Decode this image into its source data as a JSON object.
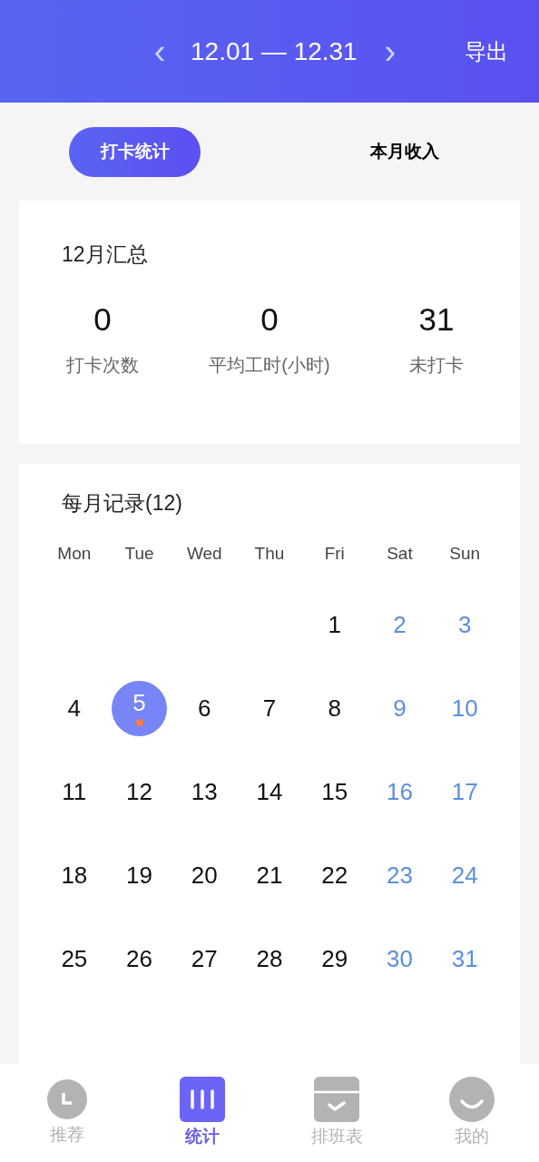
{
  "header": {
    "prev": "‹",
    "range": "12.01 — 12.31",
    "next": "›",
    "export": "导出"
  },
  "tabs": [
    {
      "label": "打卡统计",
      "selected": true
    },
    {
      "label": "本月收入",
      "selected": false
    }
  ],
  "summary": {
    "title": "12月汇总",
    "stats": [
      {
        "value": "0",
        "label": "打卡次数"
      },
      {
        "value": "0",
        "label": "平均工时(小时)"
      },
      {
        "value": "31",
        "label": "未打卡"
      }
    ]
  },
  "calendar": {
    "title": "每月记录(12)",
    "weekdays": [
      "Mon",
      "Tue",
      "Wed",
      "Thu",
      "Fri",
      "Sat",
      "Sun"
    ],
    "weeks": [
      [
        {
          "day": "1",
          "weekend": false,
          "selected": false,
          "record": false
        },
        {
          "day": "2",
          "weekend": true,
          "selected": false,
          "record": false
        },
        {
          "day": "3",
          "weekend": true,
          "selected": false,
          "record": false
        }
      ],
      [
        {
          "day": "4",
          "weekend": false,
          "selected": false,
          "record": false
        },
        {
          "day": "5",
          "weekend": false,
          "selected": true,
          "record": true
        },
        {
          "day": "6",
          "weekend": false,
          "selected": false,
          "record": false
        },
        {
          "day": "7",
          "weekend": false,
          "selected": false,
          "record": false
        },
        {
          "day": "8",
          "weekend": false,
          "selected": false,
          "record": false
        },
        {
          "day": "9",
          "weekend": true,
          "selected": false,
          "record": false
        },
        {
          "day": "10",
          "weekend": true,
          "selected": false,
          "record": false
        }
      ],
      [
        {
          "day": "11",
          "weekend": false,
          "selected": false,
          "record": false
        },
        {
          "day": "12",
          "weekend": false,
          "selected": false,
          "record": false
        },
        {
          "day": "13",
          "weekend": false,
          "selected": false,
          "record": false
        },
        {
          "day": "14",
          "weekend": false,
          "selected": false,
          "record": false
        },
        {
          "day": "15",
          "weekend": false,
          "selected": false,
          "record": false
        },
        {
          "day": "16",
          "weekend": true,
          "selected": false,
          "record": false
        },
        {
          "day": "17",
          "weekend": true,
          "selected": false,
          "record": false
        }
      ],
      [
        {
          "day": "18",
          "weekend": false,
          "selected": false,
          "record": false
        },
        {
          "day": "19",
          "weekend": false,
          "selected": false,
          "record": false
        },
        {
          "day": "20",
          "weekend": false,
          "selected": false,
          "record": false
        },
        {
          "day": "21",
          "weekend": false,
          "selected": false,
          "record": false
        },
        {
          "day": "22",
          "weekend": false,
          "selected": false,
          "record": false
        },
        {
          "day": "23",
          "weekend": true,
          "selected": false,
          "record": false
        },
        {
          "day": "24",
          "weekend": true,
          "selected": false,
          "record": false
        }
      ],
      [
        {
          "day": "25",
          "weekend": false,
          "selected": false,
          "record": false
        },
        {
          "day": "26",
          "weekend": false,
          "selected": false,
          "record": false
        },
        {
          "day": "27",
          "weekend": false,
          "selected": false,
          "record": false
        },
        {
          "day": "28",
          "weekend": false,
          "selected": false,
          "record": false
        },
        {
          "day": "29",
          "weekend": false,
          "selected": false,
          "record": false
        },
        {
          "day": "30",
          "weekend": true,
          "selected": false,
          "record": false
        },
        {
          "day": "31",
          "weekend": true,
          "selected": false,
          "record": false
        }
      ]
    ]
  },
  "nav": [
    {
      "kind": "clock",
      "label": "推荐",
      "selected": false
    },
    {
      "kind": "stats",
      "label": "统计",
      "selected": true
    },
    {
      "kind": "schedule",
      "label": "排班表",
      "selected": false
    },
    {
      "kind": "profile",
      "label": "我的",
      "selected": false
    }
  ]
}
